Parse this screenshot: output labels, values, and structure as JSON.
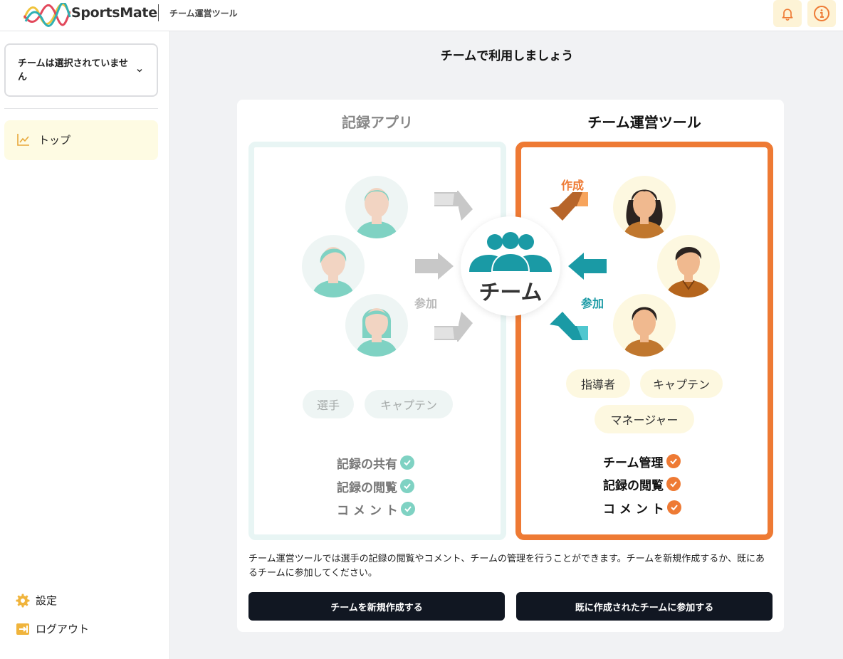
{
  "header": {
    "brand": "SportsMate",
    "app_name": "チーム運営ツール",
    "notifications_icon": "bell-icon",
    "info_icon": "info-icon"
  },
  "sidebar": {
    "team_select": {
      "value": "チームは選択されていません"
    },
    "nav": [
      {
        "label": "トップ",
        "icon": "chart-line-icon",
        "active": true
      }
    ],
    "settings_label": "設定",
    "logout_label": "ログアウト"
  },
  "main": {
    "title": "チームで利用しましょう",
    "record_app": {
      "title": "記録アプリ",
      "flow_label": "参加",
      "center_label": "チーム",
      "roles": [
        "選手",
        "キャプテン"
      ],
      "features": [
        "記録の共有",
        "記録の閲覧",
        "コ メ ン ト"
      ]
    },
    "management_tool": {
      "title": "チーム運営ツール",
      "create_label": "作成",
      "join_label": "参加",
      "roles": [
        "指導者",
        "キャプテン",
        "マネージャー"
      ],
      "features": [
        "チーム管理",
        "記録の閲覧",
        "コ メ ン ト"
      ]
    },
    "description": "チーム運営ツールでは選手の記録の閲覧やコメント、チームの管理を行うことができます。チームを新規作成するか、既にあるチームに参加してください。",
    "create_button": "チームを新規作成する",
    "join_button": "既に作成されたチームに参加する"
  },
  "colors": {
    "accent_orange": "#ee7a34",
    "accent_teal": "#1a9aa5",
    "button_dark": "#111722",
    "highlight_yellow": "#fefbe3"
  }
}
